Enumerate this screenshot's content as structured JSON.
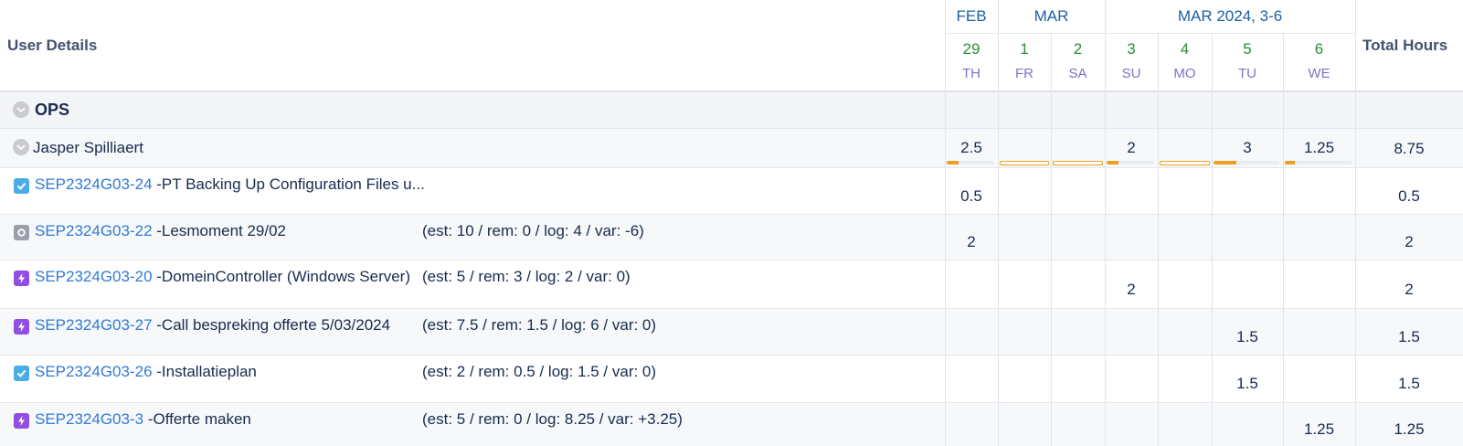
{
  "header": {
    "user_details_label": "User Details",
    "total_hours_label": "Total Hours",
    "months": [
      "FEB",
      "MAR",
      "MAR 2024, 3-6"
    ],
    "days": [
      {
        "num": "29",
        "name": "TH"
      },
      {
        "num": "1",
        "name": "FR"
      },
      {
        "num": "2",
        "name": "SA"
      },
      {
        "num": "3",
        "name": "SU"
      },
      {
        "num": "4",
        "name": "MO"
      },
      {
        "num": "5",
        "name": "TU"
      },
      {
        "num": "6",
        "name": "WE"
      }
    ]
  },
  "group": {
    "name": "OPS"
  },
  "user": {
    "name": "Jasper Spilliaert",
    "values": [
      "2.5",
      "",
      "",
      "2",
      "",
      "3",
      "1.25"
    ],
    "capacity_fill": [
      0.25,
      0,
      0,
      0.25,
      0,
      0.35,
      0.15
    ],
    "total": "8.75"
  },
  "issues": [
    {
      "key": "SEP2324G03-24",
      "summary": " -PT Backing Up Configuration Files u...",
      "est": "",
      "type": "task",
      "values": [
        "0.5",
        "",
        "",
        "",
        "",
        "",
        ""
      ],
      "total": "0.5"
    },
    {
      "key": "SEP2324G03-22",
      "summary": " -Lesmoment 29/02",
      "est": "(est: 10 / rem: 0 / log: 4 / var: -6)",
      "type": "subtask",
      "values": [
        "2",
        "",
        "",
        "",
        "",
        "",
        ""
      ],
      "total": "2"
    },
    {
      "key": "SEP2324G03-20",
      "summary": " -DomeinController (Windows Server)",
      "est": "(est: 5 / rem: 3 / log: 2 / var: 0)",
      "type": "epic",
      "values": [
        "",
        "",
        "",
        "2",
        "",
        "",
        ""
      ],
      "total": "2"
    },
    {
      "key": "SEP2324G03-27",
      "summary": " -Call bespreking offerte 5/03/2024",
      "est": "(est: 7.5 / rem: 1.5 / log: 6 / var: 0)",
      "type": "epic",
      "values": [
        "",
        "",
        "",
        "",
        "",
        "1.5",
        ""
      ],
      "total": "1.5"
    },
    {
      "key": "SEP2324G03-26",
      "summary": " -Installatieplan",
      "est": "(est: 2 / rem: 0.5 / log: 1.5 / var: 0)",
      "type": "task",
      "values": [
        "",
        "",
        "",
        "",
        "",
        "1.5",
        ""
      ],
      "total": "1.5"
    },
    {
      "key": "SEP2324G03-3",
      "summary": " -Offerte maken",
      "est": "(est: 5 / rem: 0 / log: 8.25 / var: +3.25)",
      "type": "epic",
      "values": [
        "",
        "",
        "",
        "",
        "",
        "",
        "1.25"
      ],
      "total": "1.25"
    }
  ],
  "colors": {
    "link": "#2f7ad8",
    "month_header": "#1f5fa3",
    "day_number": "#2e8b3c",
    "day_name": "#7b73c9",
    "capacity_bar": "#f0a020",
    "task_icon": "#4bade8",
    "subtask_icon": "#9aa0ab",
    "epic_icon": "#904ee2"
  }
}
